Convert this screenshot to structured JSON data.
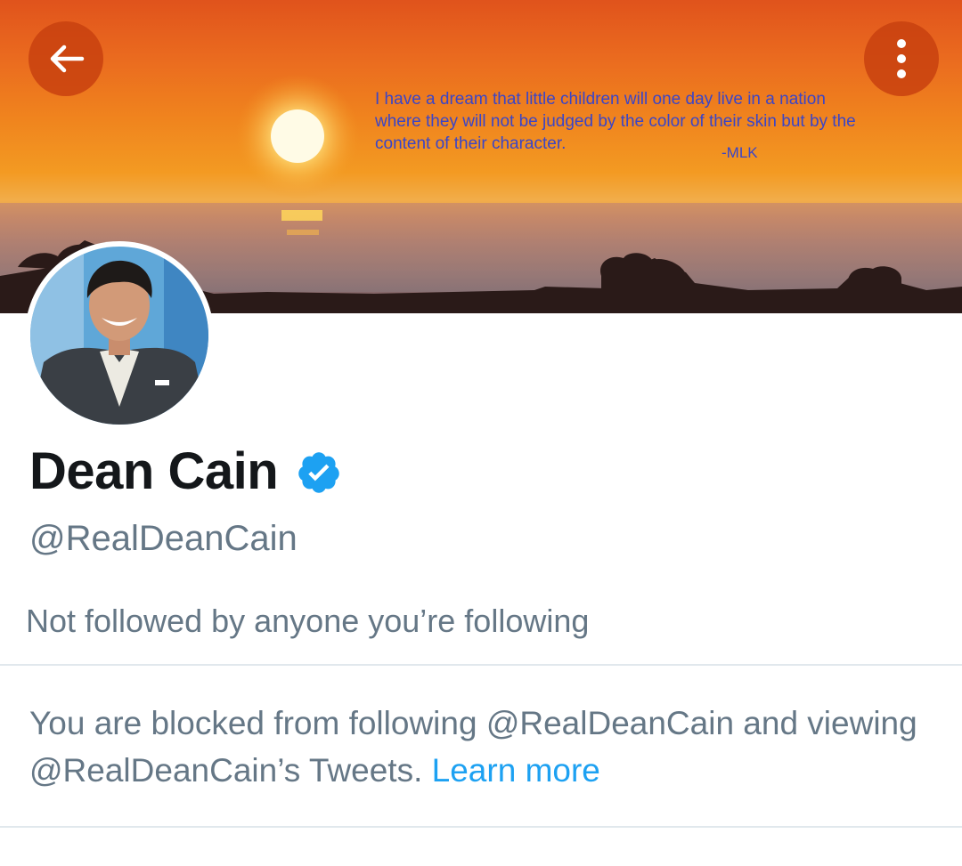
{
  "header": {
    "banner_quote": "I have a dream that little children will one day live in a nation where they will not be judged by the color of their skin but by the content of their character.",
    "banner_quote_attribution": "-MLK",
    "back_icon": "arrow-left-icon",
    "more_icon": "vertical-dots-icon"
  },
  "profile": {
    "name": "Dean Cain",
    "verified": true,
    "handle": "@RealDeanCain",
    "followed_by_text": "Not followed by anyone you’re following"
  },
  "blocked_notice": {
    "text": "You are blocked from following @RealDeanCain and viewing @RealDeanCain’s Tweets.",
    "link_label": "Learn more"
  },
  "colors": {
    "verified_badge": "#1da1f2",
    "link": "#1da1f2",
    "secondary_text": "#657786",
    "primary_text": "#14171a",
    "divider": "#e1e8ed"
  }
}
